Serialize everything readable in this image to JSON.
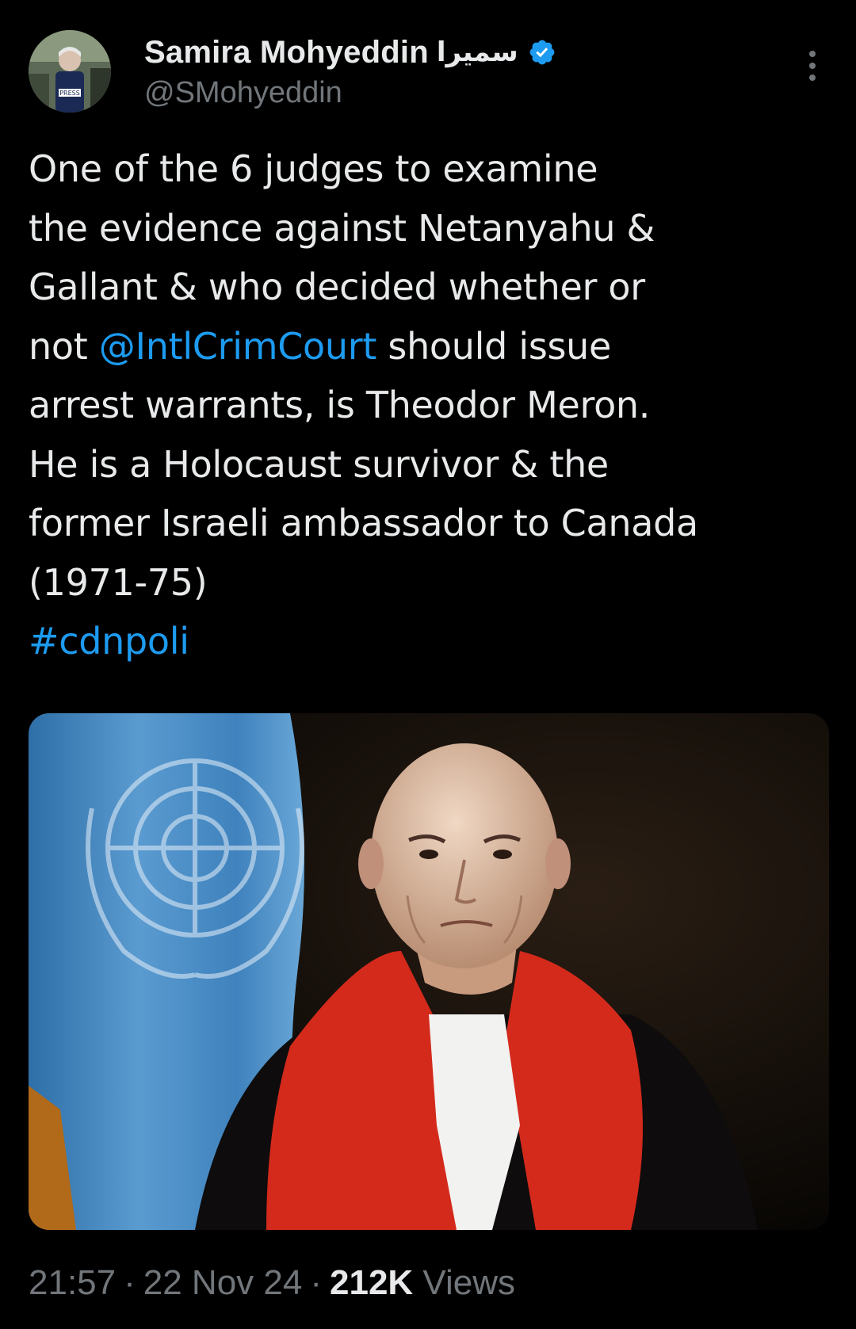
{
  "author": {
    "display_name": "Samira Mohyeddin",
    "arabic_name": "سميرا",
    "handle": "@SMohyeddin",
    "avatar_badge": "PRESS"
  },
  "tweet": {
    "lines": [
      [
        {
          "t": "One of the 6 judges to examine"
        }
      ],
      [
        {
          "t": "the evidence against Netanyahu &"
        }
      ],
      [
        {
          "t": "Gallant & who decided whether or"
        }
      ],
      [
        {
          "t": "not "
        },
        {
          "t": "@IntlCrimCourt",
          "link": true
        },
        {
          "t": " should issue"
        }
      ],
      [
        {
          "t": "arrest warrants, is Theodor Meron."
        }
      ],
      [
        {
          "t": "He is a Holocaust survivor & the"
        }
      ],
      [
        {
          "t": "former Israeli ambassador to Canada"
        }
      ],
      [
        {
          "t": "(1971-75)"
        }
      ],
      [
        {
          "t": "#cdnpoli",
          "link": true
        }
      ]
    ]
  },
  "meta": {
    "time": "21:57",
    "date": "22 Nov 24",
    "views_count": "212K",
    "views_label": "Views",
    "separator": "·"
  },
  "icons": {
    "verified": "verified-badge-icon",
    "more": "more-options-icon"
  },
  "colors": {
    "background": "#000000",
    "text": "#e7e9ea",
    "secondary": "#71767b",
    "link": "#1d9bf0",
    "verified": "#1d9bf0"
  }
}
